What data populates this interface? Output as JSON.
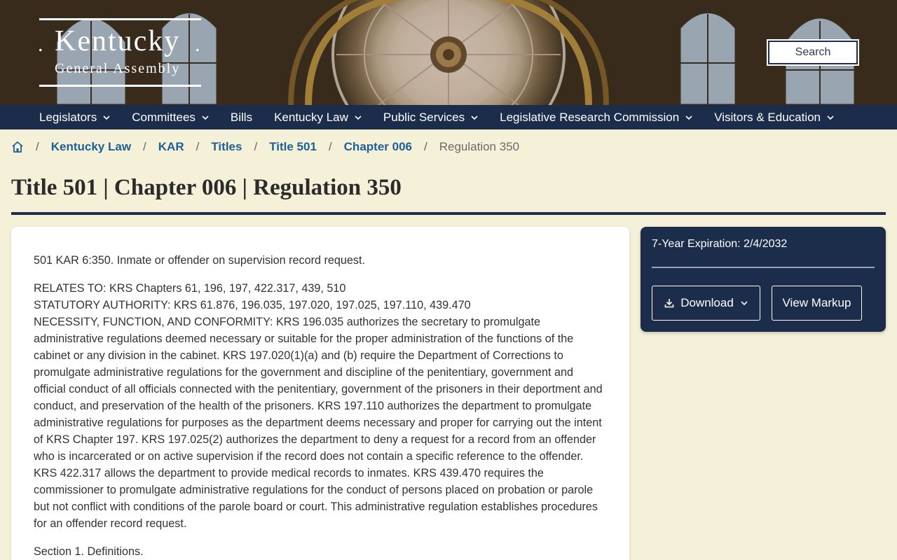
{
  "header": {
    "logo_title": "Kentucky",
    "logo_subtitle": "General Assembly",
    "search_label": "Search"
  },
  "nav": {
    "items": [
      {
        "label": "Legislators",
        "dropdown": true
      },
      {
        "label": "Committees",
        "dropdown": true
      },
      {
        "label": "Bills",
        "dropdown": false
      },
      {
        "label": "Kentucky Law",
        "dropdown": true
      },
      {
        "label": "Public Services",
        "dropdown": true
      },
      {
        "label": "Legislative Research Commission",
        "dropdown": true
      },
      {
        "label": "Visitors & Education",
        "dropdown": true
      }
    ]
  },
  "breadcrumb": {
    "home_icon": "home-icon",
    "links": [
      "Kentucky Law",
      "KAR",
      "Titles",
      "Title 501",
      "Chapter 006"
    ],
    "current": "Regulation 350"
  },
  "page": {
    "title": "Title 501 | Chapter 006 | Regulation 350"
  },
  "document": {
    "heading": "501 KAR 6:350.  Inmate or offender on supervision record request.",
    "relates_to": "RELATES TO:  KRS Chapters 61, 196, 197, 422.317, 439, 510",
    "statutory_authority": "STATUTORY AUTHORITY:  KRS 61.876, 196.035, 197.020, 197.025, 197.110, 439.470",
    "necessity": "NECESSITY, FUNCTION, AND CONFORMITY:  KRS 196.035 authorizes the secretary to promulgate administrative regulations deemed necessary or suitable for the proper administration of the functions of the cabinet or any division in the cabinet. KRS 197.020(1)(a) and (b) require the Department of Corrections to promulgate administrative regulations for the government and discipline of the penitentiary, government and official conduct of all officials connected with the penitentiary, government of the prisoners in their deportment and conduct, and preservation of the health of the prisoners. KRS 197.110 authorizes the department to promulgate administrative regulations for purposes as the department deems necessary and proper for carrying out the intent of KRS Chapter 197. KRS 197.025(2) authorizes the department to deny a request for a record from an offender who is incarcerated or on active supervision if the record does not contain a specific reference to the offender. KRS 422.317 allows the department to provide medical records to inmates. KRS 439.470 requires the commissioner to promulgate administrative regulations for the conduct of persons placed on probation or parole but not conflict with conditions of the parole board or court. This administrative regulation establishes procedures for an offender record request.",
    "section1": "Section 1.  Definitions."
  },
  "side_panel": {
    "expiration": "7-Year Expiration: 2/4/2032",
    "download_label": "Download",
    "view_markup_label": "View Markup",
    "download_icon": "download-icon"
  },
  "colors": {
    "navy": "#1b2d4b",
    "background": "#f5f0d8",
    "link": "#1d5f97"
  }
}
